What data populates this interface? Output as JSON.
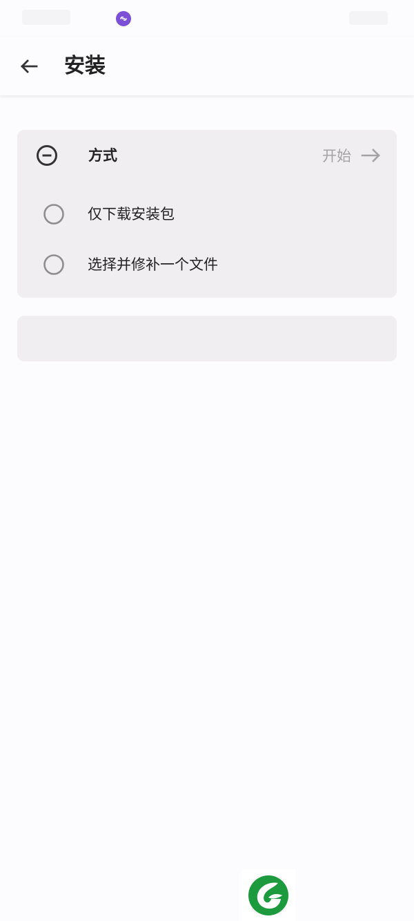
{
  "app_bar": {
    "title": "安装"
  },
  "method_card": {
    "title": "方式",
    "start_label": "开始",
    "options": [
      {
        "label": "仅下载安装包",
        "selected": false
      },
      {
        "label": "选择并修补一个文件",
        "selected": false
      }
    ]
  },
  "icons": {
    "back": "arrow-left-icon",
    "collapse": "minus-circle-icon",
    "start": "arrow-right-icon",
    "radio": "radio-unchecked-icon",
    "notification": "link-icon",
    "logo": "leaf-logo-icon"
  },
  "colors": {
    "background": "#fcfbfd",
    "card": "#f0eef0",
    "accent_muted": "#a3a3a3",
    "notification": "#7b4fd6",
    "logo": "#1e9a3e"
  }
}
